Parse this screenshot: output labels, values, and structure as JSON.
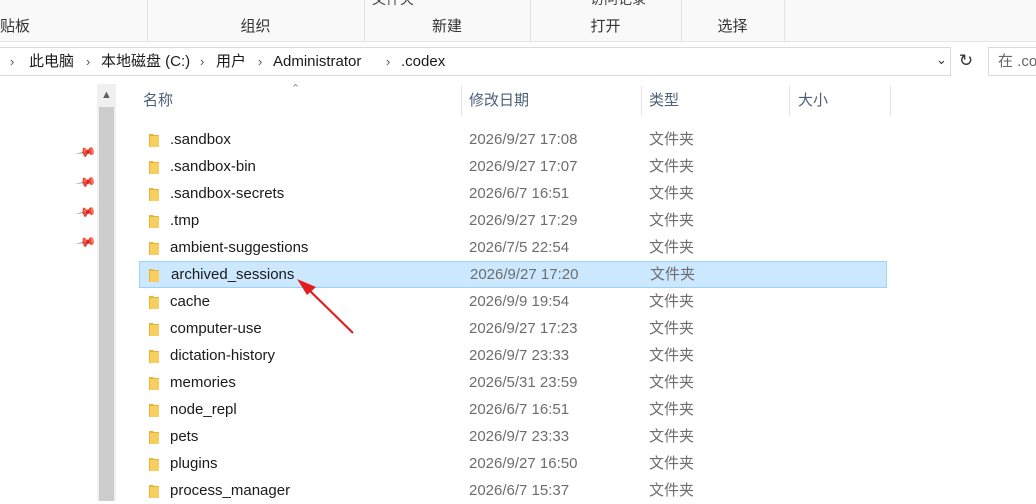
{
  "ribbon": {
    "groups": [
      {
        "label": "贴板"
      },
      {
        "label": "组织"
      },
      {
        "label": "新建",
        "partial_top": "文件夹"
      },
      {
        "label": "打开",
        "partial_top": "访问记录"
      },
      {
        "label": "选择"
      }
    ]
  },
  "address": {
    "crumbs": [
      "此电脑",
      "本地磁盘 (C:)",
      "用户",
      "Administrator",
      ".codex"
    ]
  },
  "search": {
    "placeholder": "在 .co"
  },
  "columns": {
    "name": "名称",
    "date": "修改日期",
    "type": "类型",
    "size": "大小"
  },
  "files": [
    {
      "name": ".sandbox",
      "date": "2026/9/27 17:08",
      "type": "文件夹"
    },
    {
      "name": ".sandbox-bin",
      "date": "2026/9/27 17:07",
      "type": "文件夹"
    },
    {
      "name": ".sandbox-secrets",
      "date": "2026/6/7 16:51",
      "type": "文件夹"
    },
    {
      "name": ".tmp",
      "date": "2026/9/27 17:29",
      "type": "文件夹"
    },
    {
      "name": "ambient-suggestions",
      "date": "2026/7/5 22:54",
      "type": "文件夹"
    },
    {
      "name": "archived_sessions",
      "date": "2026/9/27 17:20",
      "type": "文件夹",
      "selected": true
    },
    {
      "name": "cache",
      "date": "2026/9/9 19:54",
      "type": "文件夹"
    },
    {
      "name": "computer-use",
      "date": "2026/9/27 17:23",
      "type": "文件夹"
    },
    {
      "name": "dictation-history",
      "date": "2026/9/7 23:33",
      "type": "文件夹"
    },
    {
      "name": "memories",
      "date": "2026/5/31 23:59",
      "type": "文件夹"
    },
    {
      "name": "node_repl",
      "date": "2026/6/7 16:51",
      "type": "文件夹"
    },
    {
      "name": "pets",
      "date": "2026/9/7 23:33",
      "type": "文件夹"
    },
    {
      "name": "plugins",
      "date": "2026/9/27 16:50",
      "type": "文件夹"
    },
    {
      "name": "process_manager",
      "date": "2026/6/7 15:37",
      "type": "文件夹"
    }
  ],
  "colors": {
    "selection_bg": "#cce8ff",
    "selection_border": "#99d1ff",
    "folder": "#f5c85a",
    "annotation_arrow": "#e02020"
  },
  "icons": {
    "folder": "folder-icon",
    "pin": "pin-icon",
    "refresh": "refresh-icon",
    "sort": "sort-ascending-icon"
  }
}
